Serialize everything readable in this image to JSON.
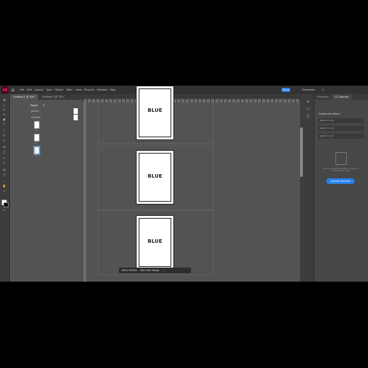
{
  "menubar": {
    "logo": "Id",
    "items": [
      "File",
      "Edit",
      "Layout",
      "Type",
      "Object",
      "Table",
      "View",
      "Plug-ins",
      "Window",
      "Help"
    ],
    "share_label": "Share",
    "workspace": "Essentials"
  },
  "tabs": [
    "Untitled-1 @ 30%",
    "Untitled-2 @ 76%"
  ],
  "pages_panel": {
    "title": "Pages",
    "masters": [
      "[None]",
      "A-Parent"
    ],
    "pages": [
      "1",
      "2",
      "3"
    ]
  },
  "document": {
    "pages": [
      {
        "text": "BLUE"
      },
      {
        "text": "BLUE"
      },
      {
        "text": "BLUE"
      }
    ]
  },
  "taskbar": {
    "add_label": "Add a Section",
    "start_label": "Start with design"
  },
  "libraries": {
    "tabs": [
      "Properties",
      "CC Libraries"
    ],
    "create_new": "Create new library",
    "rows": [
      "Search in Lib",
      "Search in Lib",
      "Search in Lib"
    ],
    "empty_text": "Use your assets anywhere across your Creative Cloud apps",
    "explore_label": "Explore libraries"
  }
}
